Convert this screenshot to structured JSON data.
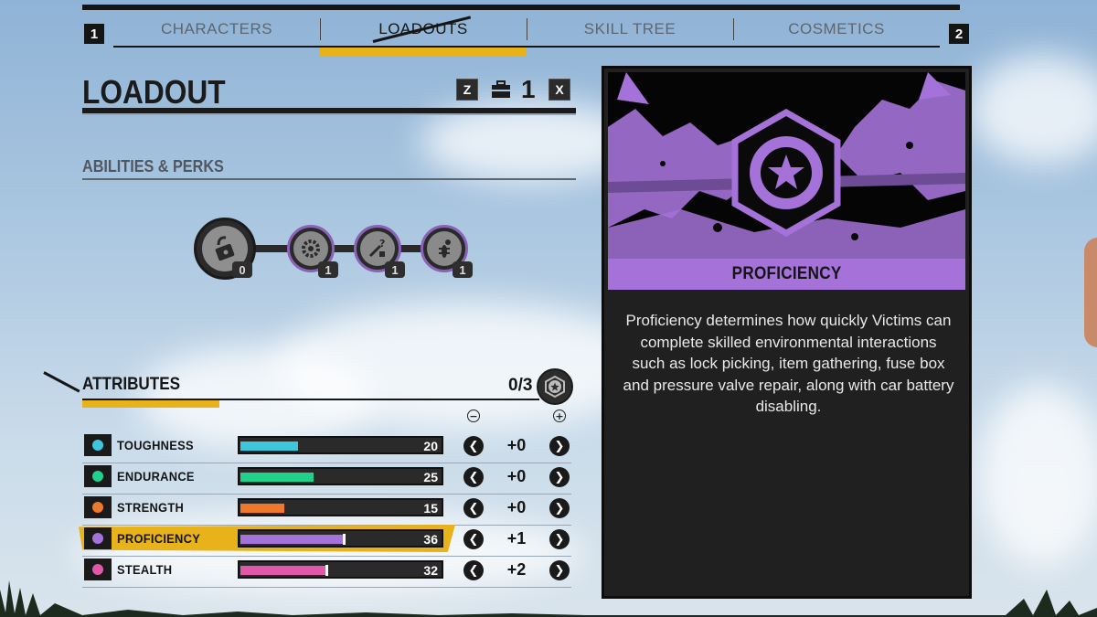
{
  "tabs": {
    "left_key": "1",
    "right_key": "2",
    "items": [
      {
        "label": "CHARACTERS",
        "active": false
      },
      {
        "label": "LOADOUTS",
        "active": true
      },
      {
        "label": "SKILL TREE",
        "active": false
      },
      {
        "label": "COSMETICS",
        "active": false
      }
    ]
  },
  "loadout": {
    "title": "LOADOUT",
    "prev_key": "Z",
    "next_key": "X",
    "number": "1",
    "icon": "briefcase-icon"
  },
  "abilities": {
    "title": "ABILITIES & PERKS",
    "perks": [
      {
        "icon": "lockpick-ability-icon",
        "count": "0"
      },
      {
        "icon": "gear-perk-icon",
        "count": "1"
      },
      {
        "icon": "tool-question-perk-icon",
        "count": "1"
      },
      {
        "icon": "bug-perk-icon",
        "count": "1"
      }
    ]
  },
  "attributes": {
    "title": "ATTRIBUTES",
    "points": "0/3",
    "minus_header_icon": "minus-circle-icon",
    "plus_header_icon": "plus-circle-icon",
    "rows": [
      {
        "label": "TOUGHNESS",
        "value": "20",
        "modifier": "+0",
        "color": "#3ec6dc",
        "fill": 0.34,
        "selected": false
      },
      {
        "label": "ENDURANCE",
        "value": "25",
        "modifier": "+0",
        "color": "#1fd18b",
        "fill": 0.43,
        "selected": false
      },
      {
        "label": "STRENGTH",
        "value": "15",
        "modifier": "+0",
        "color": "#f0782a",
        "fill": 0.26,
        "selected": false
      },
      {
        "label": "PROFICIENCY",
        "value": "36",
        "modifier": "+1",
        "color": "#a472d8",
        "fill": 0.6,
        "selected": true
      },
      {
        "label": "STEALTH",
        "value": "32",
        "modifier": "+2",
        "color": "#e058a8",
        "fill": 0.5,
        "selected": false
      }
    ]
  },
  "detail": {
    "title": "PROFICIENCY",
    "description": "Proficiency determines how quickly Victims can complete skilled environmental interactions such as lock picking, item gathering, fuse box and pressure valve repair, along with car battery disabling.",
    "accent": "#a472d8",
    "icon": "star-hexagon-icon"
  }
}
